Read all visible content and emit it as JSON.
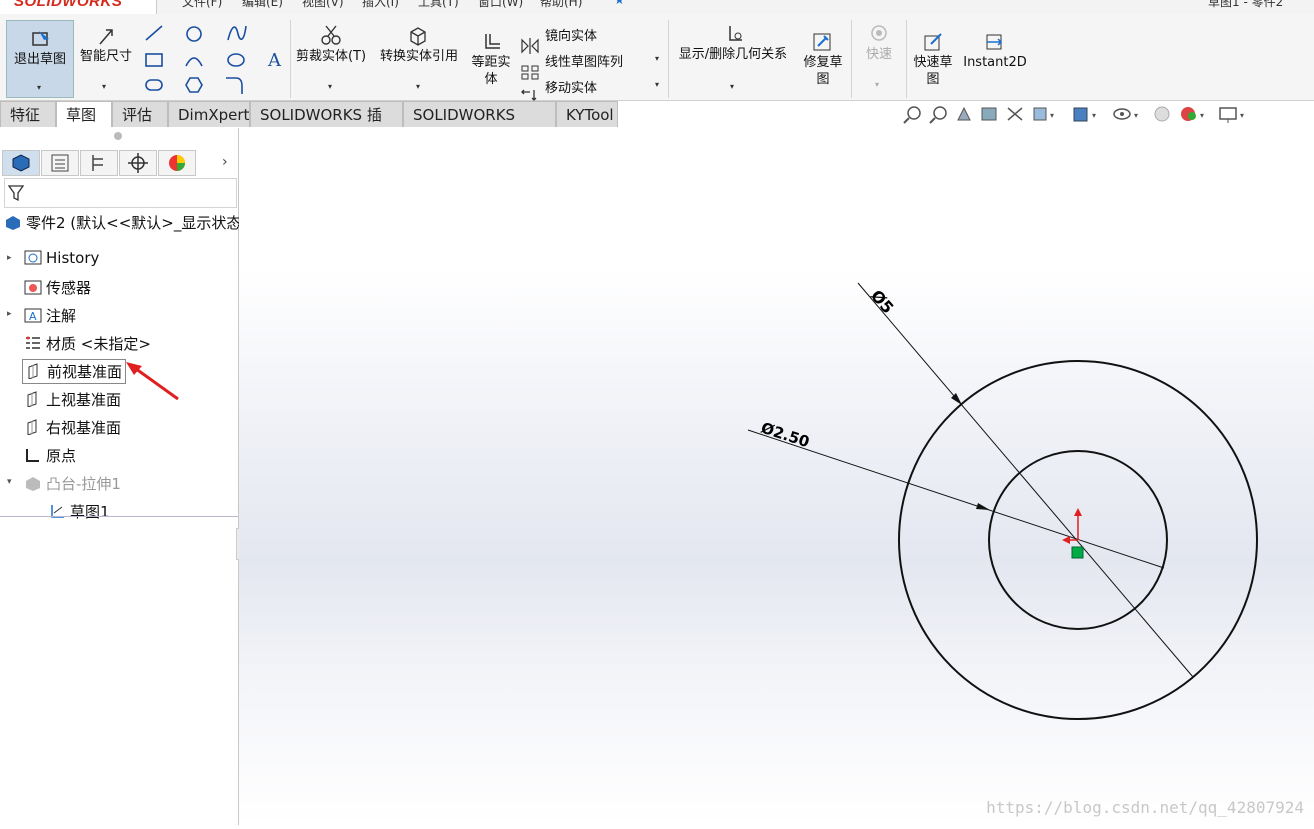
{
  "app": {
    "logo": "SOLIDWORKS",
    "doc_title": "草图1 - 零件2"
  },
  "menu": [
    "文件(F)",
    "编辑(E)",
    "视图(V)",
    "插入(I)",
    "工具(T)",
    "窗口(W)",
    "帮助(H)"
  ],
  "toolbar": {
    "exit_sketch": "退出草图",
    "smart_dim": "智能尺寸",
    "trim": "剪裁实体(T)",
    "convert": "转换实体引用",
    "offset": "等距实\n体",
    "mirror": "镜向实体",
    "linear_pattern": "线性草图阵列",
    "move": "移动实体",
    "show_relations": "显示/删除几何关系",
    "repair": "修复草\n图",
    "rapid": "快速",
    "rapid_sketch": "快速草\n图",
    "instant2d": "Instant2D"
  },
  "tabs": [
    "特征",
    "草图",
    "评估",
    "DimXpert",
    "SOLIDWORKS 插件",
    "SOLIDWORKS MBD",
    "KYTool"
  ],
  "active_tab": "草图",
  "tree": {
    "root": "零件2 (默认<<默认>_显示状态",
    "items": [
      {
        "label": "History",
        "icon": "history-icon",
        "expand": true
      },
      {
        "label": "传感器",
        "icon": "sensor-icon",
        "expand": false
      },
      {
        "label": "注解",
        "icon": "annotation-icon",
        "expand": true
      },
      {
        "label": "材质 <未指定>",
        "icon": "material-icon",
        "expand": false
      },
      {
        "label": "前视基准面",
        "icon": "plane-icon",
        "expand": false
      },
      {
        "label": "上视基准面",
        "icon": "plane-icon",
        "expand": false
      },
      {
        "label": "右视基准面",
        "icon": "plane-icon",
        "expand": false
      },
      {
        "label": "原点",
        "icon": "origin-icon",
        "expand": false
      },
      {
        "label": "凸台-拉伸1",
        "icon": "extrude-icon",
        "expand": true
      },
      {
        "label": "草图1",
        "icon": "sketch-icon",
        "expand": false
      }
    ]
  },
  "sketch": {
    "dim_outer": "Ø5",
    "dim_inner": "Ø2.50",
    "outer_diameter": 5,
    "inner_diameter": 2.5
  },
  "colors": {
    "accent": "#d52b1e",
    "arrow": "#e02020",
    "origin": "#00aa44"
  },
  "watermark": "https://blog.csdn.net/qq_42807924"
}
